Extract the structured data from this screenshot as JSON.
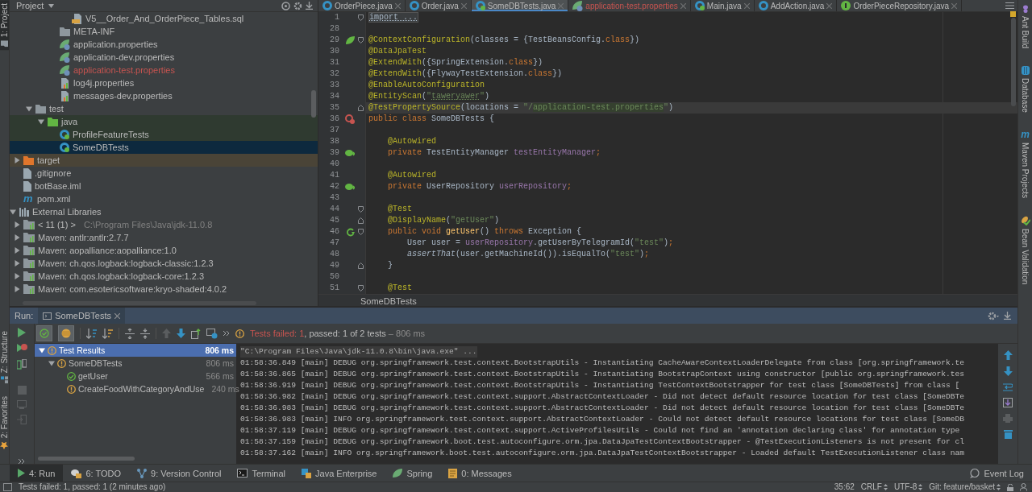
{
  "left_stripe": {
    "top": [
      {
        "label": "1: Project",
        "kind": "project",
        "selected": true
      }
    ],
    "bottom": [
      {
        "label": "Z: Structure",
        "kind": "structure",
        "selected": false
      },
      {
        "label": "2: Favorites",
        "kind": "favorites",
        "selected": false
      }
    ]
  },
  "project_panel": {
    "title": "Project",
    "tree": [
      {
        "children": [
          {
            "children": [
              {
                "children": [
                  {
                    "children": [
                      {
                        "children": [
                          {
                            "label": "V5__Order_And_OrderPiece_Tables.sql",
                            "kind": "sql",
                            "selected": false,
                            "error": false
                          }
                        ]
                      },
                      {
                        "label": "META-INF",
                        "kind": "folder",
                        "selected": false,
                        "error": false
                      },
                      {
                        "label": "application.properties",
                        "kind": "spring-props",
                        "selected": false,
                        "error": false
                      },
                      {
                        "label": "application-dev.properties",
                        "kind": "spring-props",
                        "selected": false,
                        "error": false
                      },
                      {
                        "label": "application-test.properties",
                        "kind": "spring-props",
                        "selected": false,
                        "error": true
                      },
                      {
                        "label": "log4j.properties",
                        "kind": "props",
                        "selected": false,
                        "error": false
                      },
                      {
                        "label": "messages-dev.properties",
                        "kind": "props",
                        "selected": false,
                        "error": false
                      }
                    ]
                  }
                ]
              },
              {
                "label": "test",
                "kind": "folder",
                "expanded": true,
                "selected": false,
                "error": false,
                "children": [
                  {
                    "label": "java",
                    "kind": "test-folder",
                    "expanded": true,
                    "selected": false,
                    "error": false,
                    "children": [
                      {
                        "label": "ProfileFeatureTests",
                        "kind": "test-class",
                        "selected": false,
                        "error": false
                      },
                      {
                        "label": "SomeDBTests",
                        "kind": "test-class",
                        "selected": true,
                        "error": false
                      }
                    ]
                  }
                ]
              }
            ]
          },
          {
            "label": "target",
            "kind": "excluded-folder",
            "expanded": false,
            "selected": false,
            "error": false
          },
          {
            "label": ".gitignore",
            "kind": "file",
            "selected": false,
            "error": false
          },
          {
            "label": "botBase.iml",
            "kind": "file",
            "selected": false,
            "error": false
          },
          {
            "label": "pom.xml",
            "kind": "maven",
            "icon_text": "m",
            "selected": false,
            "error": false
          }
        ]
      },
      {
        "label": "External Libraries",
        "kind": "libraries",
        "expanded": true,
        "selected": false,
        "error": false,
        "children": [
          {
            "label": "< 11 (1) >",
            "detail": "C:\\Program Files\\Java\\jdk-11.0.8",
            "kind": "library",
            "expanded": false,
            "selected": false,
            "error": false
          },
          {
            "label": "Maven: antlr:antlr:2.7.7",
            "kind": "library",
            "expanded": false,
            "selected": false,
            "error": false
          },
          {
            "label": "Maven: aopalliance:aopalliance:1.0",
            "kind": "library",
            "expanded": false,
            "selected": false,
            "error": false
          },
          {
            "label": "Maven: ch.qos.logback:logback-classic:1.2.3",
            "kind": "library",
            "expanded": false,
            "selected": false,
            "error": false
          },
          {
            "label": "Maven: ch.qos.logback:logback-core:1.2.3",
            "kind": "library",
            "expanded": false,
            "selected": false,
            "error": false
          },
          {
            "label": "Maven: com.esotericsoftware:kryo-shaded:4.0.2",
            "kind": "library",
            "expanded": false,
            "selected": false,
            "error": false
          }
        ]
      }
    ]
  },
  "editor": {
    "tabs": [
      {
        "label": "OrderPiece.java",
        "kind": "class",
        "selected": false,
        "error": false
      },
      {
        "label": "Order.java",
        "kind": "class",
        "selected": false,
        "error": false
      },
      {
        "label": "SomeDBTests.java",
        "kind": "test-class",
        "selected": true,
        "error": false
      },
      {
        "label": "application-test.properties",
        "kind": "spring-props",
        "selected": false,
        "error": true
      },
      {
        "label": "Main.java",
        "kind": "main-class",
        "selected": false,
        "error": false
      },
      {
        "label": "AddAction.java",
        "kind": "class",
        "selected": false,
        "error": false
      },
      {
        "label": "OrderPieceRepository.java",
        "kind": "interface",
        "selected": false,
        "error": false
      }
    ],
    "lines": [
      {
        "number": "1",
        "marks": [
          {
            "kind": "fold-start"
          }
        ],
        "current": false,
        "tokens": [
          {
            "kind": "folded",
            "text": "import ..."
          }
        ]
      },
      {
        "number": "28",
        "current": false
      },
      {
        "number": "29",
        "marks": [
          {
            "kind": "bean"
          },
          {
            "kind": "fold-start"
          }
        ],
        "current": false,
        "tokens": [
          {
            "kind": "annotation",
            "text": "@ContextConfiguration"
          },
          {
            "kind": "plain",
            "text": "(classes = {TestBeansConfig."
          },
          {
            "kind": "keyword",
            "text": "class"
          },
          {
            "kind": "plain",
            "text": "})"
          }
        ]
      },
      {
        "number": "30",
        "current": false,
        "tokens": [
          {
            "kind": "annotation",
            "text": "@DataJpaTest"
          }
        ]
      },
      {
        "number": "31",
        "current": false,
        "tokens": [
          {
            "kind": "annotation",
            "text": "@ExtendWith"
          },
          {
            "kind": "plain",
            "text": "({SpringExtension."
          },
          {
            "kind": "keyword",
            "text": "class"
          },
          {
            "kind": "plain",
            "text": "})"
          }
        ]
      },
      {
        "number": "32",
        "current": false,
        "tokens": [
          {
            "kind": "annotation",
            "text": "@ExtendWith"
          },
          {
            "kind": "plain",
            "text": "({FlywayTestExtension."
          },
          {
            "kind": "keyword",
            "text": "class"
          },
          {
            "kind": "plain",
            "text": "})"
          }
        ]
      },
      {
        "number": "33",
        "current": false,
        "tokens": [
          {
            "kind": "annotation",
            "text": "@EnableAutoConfiguration"
          }
        ]
      },
      {
        "number": "34",
        "current": false,
        "tokens": [
          {
            "kind": "annotation",
            "text": "@EntityScan"
          },
          {
            "kind": "plain",
            "text": "("
          },
          {
            "kind": "string",
            "text": "\""
          },
          {
            "kind": "typo",
            "text": "taweryawer"
          },
          {
            "kind": "string",
            "text": "\""
          },
          {
            "kind": "plain",
            "text": ")"
          }
        ]
      },
      {
        "number": "35",
        "marks": [
          {
            "kind": "fold-end"
          }
        ],
        "current": true,
        "tokens": [
          {
            "kind": "annotation",
            "text": "@TestPropertySource"
          },
          {
            "kind": "plain",
            "text": "(locations = "
          },
          {
            "kind": "string",
            "text": "\"/"
          },
          {
            "kind": "reference",
            "text": "application-test.properties"
          },
          {
            "kind": "string",
            "text": "\""
          },
          {
            "kind": "plain",
            "text": ")"
          }
        ]
      },
      {
        "number": "36",
        "marks": [
          {
            "kind": "run-error"
          }
        ],
        "current": false,
        "tokens": [
          {
            "kind": "keyword",
            "text": "public class "
          },
          {
            "kind": "plain",
            "text": "SomeDBTests {"
          }
        ]
      },
      {
        "number": "37",
        "current": false
      },
      {
        "number": "38",
        "current": false,
        "tokens": [
          {
            "kind": "annotation",
            "text": "    @Autowired"
          }
        ]
      },
      {
        "number": "39",
        "marks": [
          {
            "kind": "bean-nav"
          }
        ],
        "current": false,
        "tokens": [
          {
            "kind": "keyword",
            "text": "    private "
          },
          {
            "kind": "plain",
            "text": "TestEntityManager "
          },
          {
            "kind": "field",
            "text": "testEntityManager"
          },
          {
            "kind": "keyword",
            "text": ";"
          }
        ]
      },
      {
        "number": "40",
        "current": false
      },
      {
        "number": "41",
        "current": false,
        "tokens": [
          {
            "kind": "annotation",
            "text": "    @Autowired"
          }
        ]
      },
      {
        "number": "42",
        "marks": [
          {
            "kind": "bean-nav"
          }
        ],
        "current": false,
        "tokens": [
          {
            "kind": "keyword",
            "text": "    private "
          },
          {
            "kind": "plain",
            "text": "UserRepository "
          },
          {
            "kind": "field",
            "text": "userRepository"
          },
          {
            "kind": "keyword",
            "text": ";"
          }
        ]
      },
      {
        "number": "43",
        "current": false
      },
      {
        "number": "44",
        "marks": [
          {
            "kind": "fold-start"
          }
        ],
        "current": false,
        "tokens": [
          {
            "kind": "annotation",
            "text": "    @Test"
          }
        ]
      },
      {
        "number": "45",
        "marks": [
          {
            "kind": "fold-end"
          }
        ],
        "current": false,
        "tokens": [
          {
            "kind": "annotation",
            "text": "    @DisplayName"
          },
          {
            "kind": "plain",
            "text": "("
          },
          {
            "kind": "string",
            "text": "\"getUser\""
          },
          {
            "kind": "plain",
            "text": ")"
          }
        ]
      },
      {
        "number": "46",
        "marks": [
          {
            "kind": "run"
          },
          {
            "kind": "fold-start"
          }
        ],
        "current": false,
        "tokens": [
          {
            "kind": "keyword",
            "text": "    public void "
          },
          {
            "kind": "method",
            "text": "getUser"
          },
          {
            "kind": "plain",
            "text": "() "
          },
          {
            "kind": "keyword",
            "text": "throws "
          },
          {
            "kind": "plain",
            "text": "Exception {"
          }
        ]
      },
      {
        "number": "47",
        "current": false,
        "tokens": [
          {
            "kind": "plain",
            "text": "        User user = "
          },
          {
            "kind": "field",
            "text": "userRepository"
          },
          {
            "kind": "plain",
            "text": ".getUserByTelegramId("
          },
          {
            "kind": "string",
            "text": "\"test\""
          },
          {
            "kind": "plain",
            "text": ")"
          },
          {
            "kind": "keyword",
            "text": ";"
          }
        ]
      },
      {
        "number": "48",
        "current": false,
        "tokens": [
          {
            "kind": "italic",
            "text": "        assertThat"
          },
          {
            "kind": "plain",
            "text": "(user.getMachineId()).isEqualTo("
          },
          {
            "kind": "string",
            "text": "\"test\""
          },
          {
            "kind": "plain",
            "text": ")"
          },
          {
            "kind": "keyword",
            "text": ";"
          }
        ]
      },
      {
        "number": "49",
        "marks": [
          {
            "kind": "fold-end"
          }
        ],
        "current": false,
        "tokens": [
          {
            "kind": "plain",
            "text": "    }"
          }
        ]
      },
      {
        "number": "50",
        "current": false
      },
      {
        "number": "51",
        "marks": [
          {
            "kind": "fold-start"
          }
        ],
        "current": false,
        "tokens": [
          {
            "kind": "annotation",
            "text": "    @Test"
          }
        ]
      }
    ],
    "breadcrumb": "SomeDBTests"
  },
  "right_stripe": [
    {
      "label": "Ant Build",
      "kind": "ant",
      "selected": false
    },
    {
      "label": "Database",
      "kind": "database",
      "selected": false
    },
    {
      "label": "Maven Projects",
      "kind": "maven",
      "icon_text": "m",
      "selected": false
    },
    {
      "label": "Bean Validation",
      "kind": "bean",
      "selected": false
    }
  ],
  "run_panel": {
    "title": "Run:",
    "tab": "SomeDBTests",
    "toggles": [
      {
        "kind": "passed",
        "on": true
      },
      {
        "kind": "ignored",
        "on": true
      }
    ],
    "status": {
      "failed": "Tests failed: 1",
      "passed": ", passed: 1 of 2 tests",
      "duration": " – 806 ms"
    },
    "tests": [
      {
        "label": "Test Results",
        "kind": "warn",
        "time": "806 ms",
        "selected": true,
        "expanded": true,
        "children": [
          {
            "label": "SomeDBTests",
            "kind": "warn",
            "time": "806 ms",
            "selected": false,
            "expanded": true,
            "children": [
              {
                "label": "getUser",
                "kind": "pass",
                "time": "566 ms",
                "selected": false
              },
              {
                "label": "CreateFoodWithCategoryAndUse",
                "kind": "warn",
                "time": "240 ms",
                "selected": false
              }
            ]
          }
        ]
      }
    ],
    "console": [
      {
        "kind": "command",
        "text": "\"C:\\Program Files\\Java\\jdk-11.0.8\\bin\\java.exe\" ..."
      },
      {
        "kind": "log",
        "text": "01:58:36.849 [main] DEBUG org.springframework.test.context.BootstrapUtils - Instantiating CacheAwareContextLoaderDelegate from class [org.springframework.te"
      },
      {
        "kind": "log",
        "text": "01:58:36.865 [main] DEBUG org.springframework.test.context.BootstrapUtils - Instantiating BootstrapContext using constructor [public org.springframework.tes"
      },
      {
        "kind": "log",
        "text": "01:58:36.919 [main] DEBUG org.springframework.test.context.BootstrapUtils - Instantiating TestContextBootstrapper for test class [SomeDBTests] from class ["
      },
      {
        "kind": "log",
        "text": "01:58:36.982 [main] DEBUG org.springframework.test.context.support.AbstractContextLoader - Did not detect default resource location for test class [SomeDBTe"
      },
      {
        "kind": "log",
        "text": "01:58:36.983 [main] DEBUG org.springframework.test.context.support.AbstractContextLoader - Did not detect default resource location for test class [SomeDBTe"
      },
      {
        "kind": "log",
        "text": "01:58:36.983 [main] INFO org.springframework.test.context.support.AbstractContextLoader - Could not detect default resource locations for test class [SomeDB"
      },
      {
        "kind": "log",
        "text": "01:58:37.119 [main] DEBUG org.springframework.test.context.support.ActiveProfilesUtils - Could not find an 'annotation declaring class' for annotation type"
      },
      {
        "kind": "log",
        "text": "01:58:37.159 [main] DEBUG org.springframework.boot.test.autoconfigure.orm.jpa.DataJpaTestContextBootstrapper - @TestExecutionListeners is not present for cl"
      },
      {
        "kind": "log",
        "text": "01:58:37.162 [main] INFO org.springframework.boot.test.autoconfigure.orm.jpa.DataJpaTestContextBootstrapper - Loaded default TestExecutionListener class nam"
      }
    ]
  },
  "tool_tabs": [
    {
      "label": "4: Run",
      "kind": "run",
      "selected": true
    },
    {
      "label": "6: TODO",
      "kind": "todo",
      "selected": false
    },
    {
      "label": "9: Version Control",
      "kind": "vcs",
      "selected": false
    },
    {
      "label": "Terminal",
      "kind": "terminal",
      "selected": false
    },
    {
      "label": "Java Enterprise",
      "kind": "javaee",
      "selected": false
    },
    {
      "label": "Spring",
      "kind": "spring",
      "selected": false
    },
    {
      "label": "0: Messages",
      "kind": "messages",
      "selected": false
    }
  ],
  "event_log": "Event Log",
  "status_bar": {
    "message": "Tests failed: 1, passed: 1 (2 minutes ago)",
    "position": "35:62",
    "line_separator": "CRLF",
    "encoding": "UTF-8",
    "vcs": "Git: feature/basket"
  }
}
